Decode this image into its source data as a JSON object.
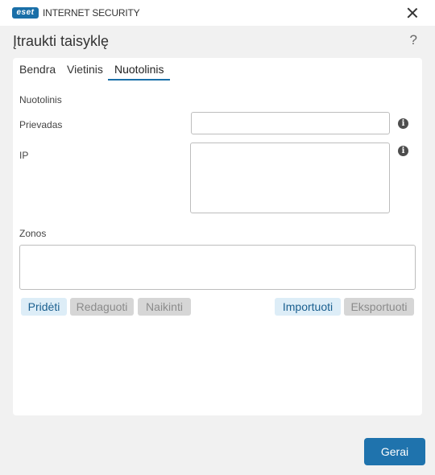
{
  "titlebar": {
    "logo_text": "eset",
    "product": "INTERNET SECURITY"
  },
  "dialog": {
    "title": "Įtraukti taisyklę",
    "help_symbol": "?"
  },
  "tabs": [
    {
      "label": "Bendra",
      "active": false
    },
    {
      "label": "Vietinis",
      "active": false
    },
    {
      "label": "Nuotolinis",
      "active": true
    }
  ],
  "remote": {
    "section_label": "Nuotolinis",
    "port_label": "Prievadas",
    "port_value": "",
    "ip_label": "IP",
    "ip_value": "",
    "zones_label": "Zonos",
    "zones_value": ""
  },
  "info_symbol": "i",
  "buttons": {
    "add": "Pridėti",
    "edit": "Redaguoti",
    "delete": "Naikinti",
    "import": "Importuoti",
    "export": "Eksportuoti"
  },
  "footer": {
    "ok": "Gerai"
  },
  "colors": {
    "accent": "#1f73ad",
    "enabled_button_bg": "#ddedf7",
    "disabled_button_bg": "#d6d6d6"
  }
}
